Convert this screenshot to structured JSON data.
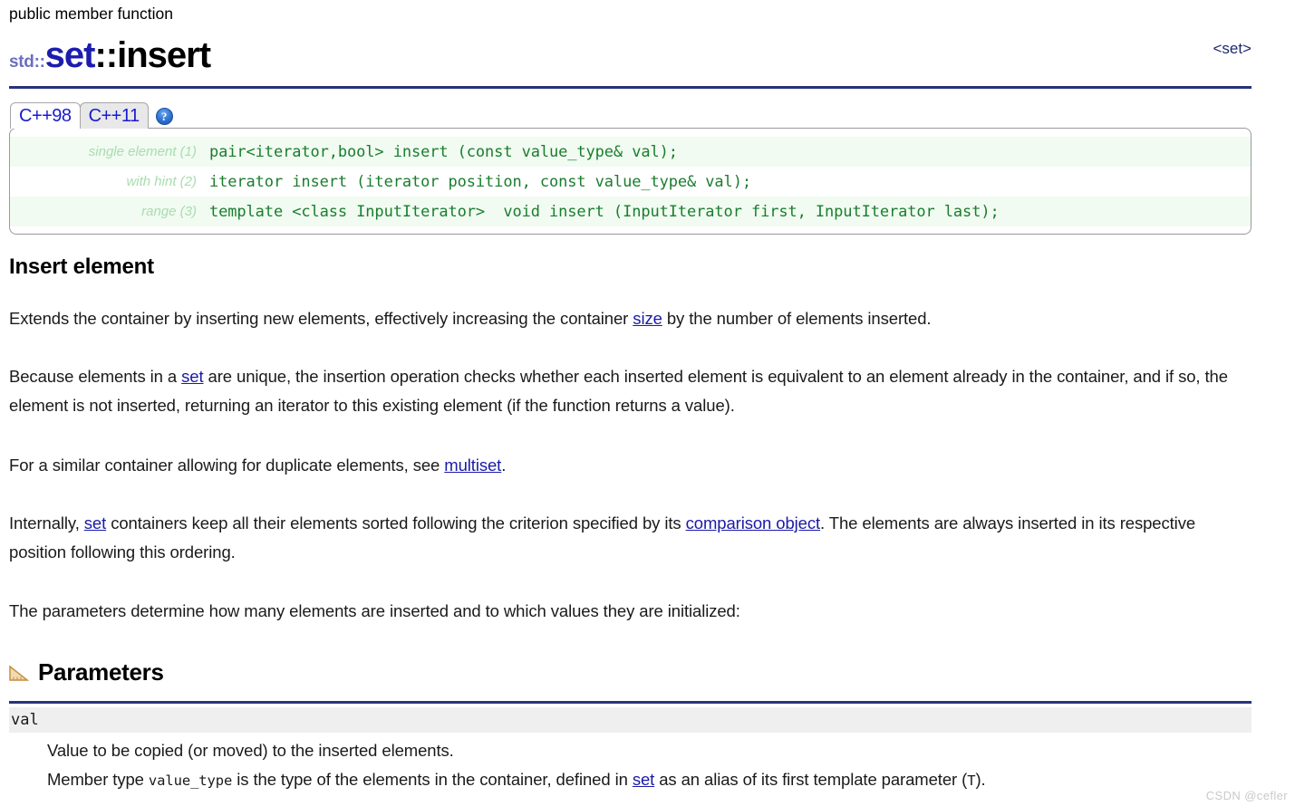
{
  "header": {
    "kicker": "public member function",
    "namespace": "std::",
    "class_name": "set",
    "scope_separator": "::",
    "function_name": "insert",
    "include_header": "<set>",
    "rule_color": "#27337a"
  },
  "tabs": {
    "items": [
      {
        "label": "C++98",
        "active": true
      },
      {
        "label": "C++11",
        "active": false
      }
    ],
    "help_icon": "?",
    "help_icon_name": "help-icon"
  },
  "signatures": {
    "rows": [
      {
        "label": "single element (1)",
        "code": "pair<iterator,bool> insert (const value_type& val);"
      },
      {
        "label": "with hint (2)",
        "code": "iterator insert (iterator position, const value_type& val);"
      },
      {
        "label": "range (3)",
        "code": "template <class InputIterator>  void insert (InputIterator first, InputIterator last);"
      }
    ],
    "code_color": "#1a7d2e",
    "label_color": "#a9dcb0",
    "row_tint": "#f1fbf1"
  },
  "body": {
    "heading": "Insert element",
    "paragraphs": [
      {
        "parts": [
          {
            "type": "text",
            "value": "Extends the container by inserting new elements, effectively increasing the container "
          },
          {
            "type": "link",
            "value": "size"
          },
          {
            "type": "text",
            "value": " by the number of elements inserted."
          }
        ]
      },
      {
        "parts": [
          {
            "type": "text",
            "value": "Because elements in a "
          },
          {
            "type": "link",
            "value": "set"
          },
          {
            "type": "text",
            "value": " are unique, the insertion operation checks whether each inserted element is equivalent to an element already in the container, and if so, the element is not inserted, returning an iterator to this existing element (if the function returns a value)."
          }
        ]
      },
      {
        "parts": [
          {
            "type": "text",
            "value": "For a similar container allowing for duplicate elements, see "
          },
          {
            "type": "link",
            "value": "multiset"
          },
          {
            "type": "text",
            "value": "."
          }
        ]
      },
      {
        "parts": [
          {
            "type": "text",
            "value": "Internally, "
          },
          {
            "type": "link",
            "value": "set"
          },
          {
            "type": "text",
            "value": " containers keep all their elements sorted following the criterion specified by its "
          },
          {
            "type": "link",
            "value": "comparison object"
          },
          {
            "type": "text",
            "value": ". The elements are always inserted in its respective position following this ordering."
          }
        ]
      },
      {
        "parts": [
          {
            "type": "text",
            "value": "The parameters determine how many elements are inserted and to which values they are initialized:"
          }
        ]
      }
    ],
    "link_color": "#1a1aa8"
  },
  "parameters": {
    "section_title": "Parameters",
    "section_icon": "ruler-icon",
    "param_name": "val",
    "description_line_1": "Value to be copied (or moved) to the inserted elements.",
    "description_line_2": {
      "prefix": "Member type ",
      "mono_1": "value_type",
      "middle": " is the type of the elements in the container, defined in ",
      "link": "set",
      "after_link": " as an alias of its first template parameter (",
      "mono_2": "T",
      "suffix": ")."
    }
  },
  "watermark": {
    "text": "CSDN @cefler"
  }
}
